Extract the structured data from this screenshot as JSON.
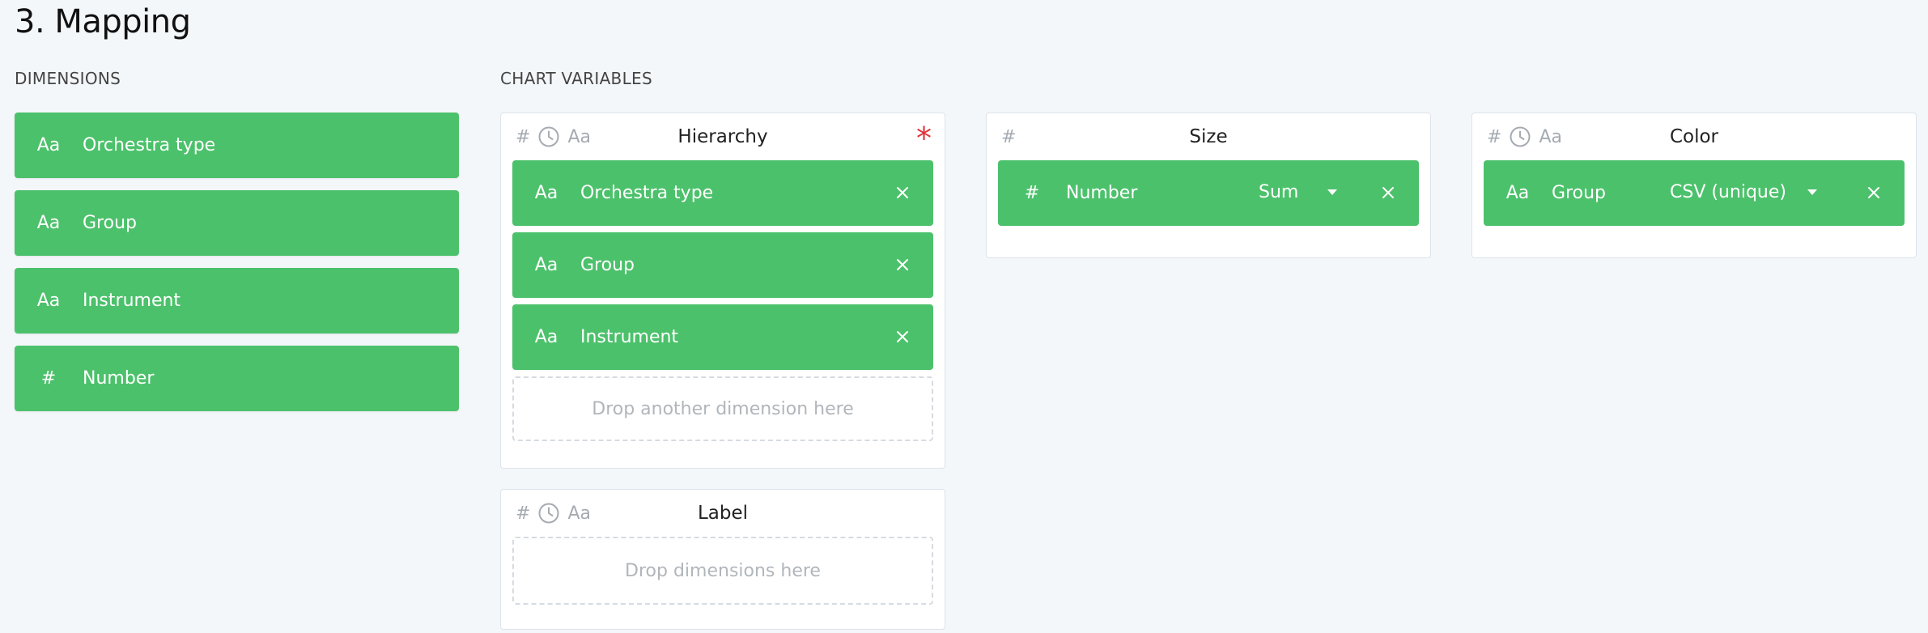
{
  "page": {
    "title": "3. Mapping"
  },
  "dimensions": {
    "label": "DIMENSIONS",
    "items": [
      {
        "type_icon": "Aa",
        "name": "Orchestra type"
      },
      {
        "type_icon": "Aa",
        "name": "Group"
      },
      {
        "type_icon": "Aa",
        "name": "Instrument"
      },
      {
        "type_icon": "#",
        "name": "Number"
      }
    ]
  },
  "chart_variables": {
    "label": "CHART VARIABLES",
    "hierarchy": {
      "title": "Hierarchy",
      "accepted_types": [
        "#",
        "clock-icon",
        "Aa"
      ],
      "required_mark": "*",
      "mapped": [
        {
          "type_icon": "Aa",
          "name": "Orchestra type"
        },
        {
          "type_icon": "Aa",
          "name": "Group"
        },
        {
          "type_icon": "Aa",
          "name": "Instrument"
        }
      ],
      "drop_placeholder": "Drop another dimension here"
    },
    "label_var": {
      "title": "Label",
      "accepted_types": [
        "#",
        "clock-icon",
        "Aa"
      ],
      "drop_placeholder": "Drop dimensions here"
    },
    "size": {
      "title": "Size",
      "accepted_types": [
        "#"
      ],
      "mapped": [
        {
          "type_icon": "#",
          "name": "Number",
          "aggregation": "Sum"
        }
      ]
    },
    "color": {
      "title": "Color",
      "accepted_types": [
        "#",
        "clock-icon",
        "Aa"
      ],
      "mapped": [
        {
          "type_icon": "Aa",
          "name": "Group",
          "aggregation": "CSV (unique)"
        }
      ]
    }
  },
  "colors": {
    "chip_green": "#4cc16b",
    "required_red": "#e0323a",
    "background": "#f4f7fa"
  }
}
